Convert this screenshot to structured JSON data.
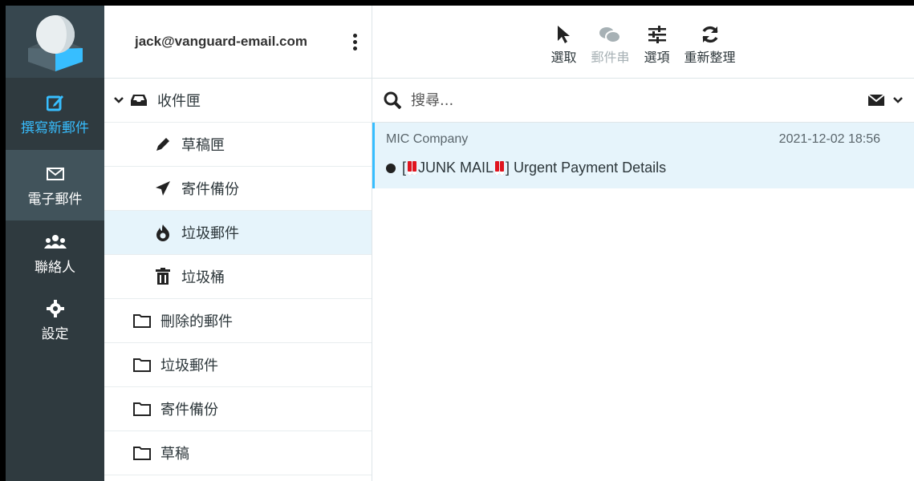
{
  "rail": {
    "items": [
      {
        "label": "撰寫新郵件",
        "icon": "compose-icon"
      },
      {
        "label": "電子郵件",
        "icon": "envelope-icon"
      },
      {
        "label": "聯絡人",
        "icon": "users-icon"
      },
      {
        "label": "設定",
        "icon": "gear-icon"
      }
    ]
  },
  "account": {
    "email": "jack@vanguard-email.com"
  },
  "folders": [
    {
      "label": "收件匣",
      "icon": "inbox-icon"
    },
    {
      "label": "草稿匣",
      "icon": "pencil-icon"
    },
    {
      "label": "寄件備份",
      "icon": "paper-plane-icon"
    },
    {
      "label": "垃圾郵件",
      "icon": "fire-icon"
    },
    {
      "label": "垃圾桶",
      "icon": "trash-icon"
    },
    {
      "label": "刪除的郵件",
      "icon": "folder-icon"
    },
    {
      "label": "垃圾郵件",
      "icon": "folder-icon"
    },
    {
      "label": "寄件備份",
      "icon": "folder-icon"
    },
    {
      "label": "草稿",
      "icon": "folder-icon"
    }
  ],
  "toolbar": {
    "select": "選取",
    "threads": "郵件串",
    "options": "選項",
    "refresh": "重新整理"
  },
  "search": {
    "placeholder": "搜尋..."
  },
  "messages": [
    {
      "from": "MIC Company",
      "date": "2021-12-02 18:56",
      "subject_prefix": "[",
      "subject_junk": "JUNK MAIL",
      "subject_suffix": "] Urgent Payment Details"
    }
  ],
  "colors": {
    "accent": "#37beff",
    "rail": "#2f3a3f",
    "selected": "#e6f4fb",
    "alert": "#e0141e"
  }
}
